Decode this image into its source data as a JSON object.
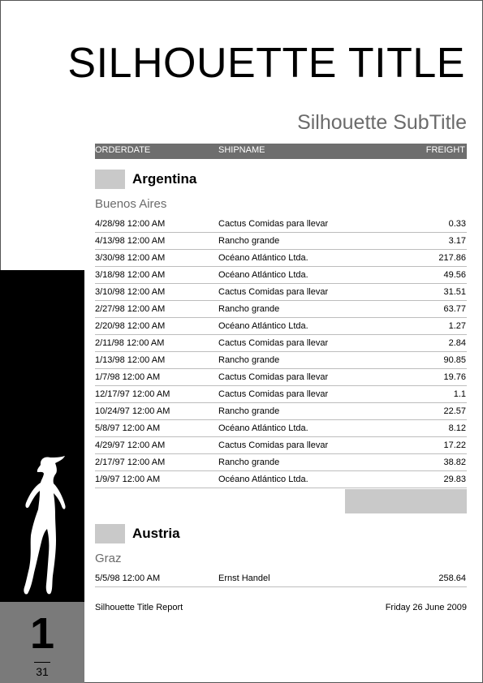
{
  "report": {
    "title": "SILHOUETTE TITLE",
    "subtitle": "Silhouette SubTitle"
  },
  "columns": {
    "orderdate": "ORDERDATE",
    "shipname": "SHIPNAME",
    "freight": "FREIGHT"
  },
  "groups": [
    {
      "country": "Argentina",
      "city": "Buenos Aires",
      "rows": [
        {
          "date": "4/28/98 12:00 AM",
          "ship": "Cactus Comidas para llevar",
          "freight": "0.33"
        },
        {
          "date": "4/13/98 12:00 AM",
          "ship": "Rancho grande",
          "freight": "3.17"
        },
        {
          "date": "3/30/98 12:00 AM",
          "ship": "Océano Atlántico Ltda.",
          "freight": "217.86"
        },
        {
          "date": "3/18/98 12:00 AM",
          "ship": "Océano Atlántico Ltda.",
          "freight": "49.56"
        },
        {
          "date": "3/10/98 12:00 AM",
          "ship": "Cactus Comidas para llevar",
          "freight": "31.51"
        },
        {
          "date": "2/27/98 12:00 AM",
          "ship": "Rancho grande",
          "freight": "63.77"
        },
        {
          "date": "2/20/98 12:00 AM",
          "ship": "Océano Atlántico Ltda.",
          "freight": "1.27"
        },
        {
          "date": "2/11/98 12:00 AM",
          "ship": "Cactus Comidas para llevar",
          "freight": "2.84"
        },
        {
          "date": "1/13/98 12:00 AM",
          "ship": "Rancho grande",
          "freight": "90.85"
        },
        {
          "date": "1/7/98 12:00 AM",
          "ship": "Cactus Comidas para llevar",
          "freight": "19.76"
        },
        {
          "date": "12/17/97 12:00 AM",
          "ship": "Cactus Comidas para llevar",
          "freight": "1.1"
        },
        {
          "date": "10/24/97 12:00 AM",
          "ship": "Rancho grande",
          "freight": "22.57"
        },
        {
          "date": "5/8/97 12:00 AM",
          "ship": "Océano Atlántico Ltda.",
          "freight": "8.12"
        },
        {
          "date": "4/29/97 12:00 AM",
          "ship": "Cactus Comidas para llevar",
          "freight": "17.22"
        },
        {
          "date": "2/17/97 12:00 AM",
          "ship": "Rancho grande",
          "freight": "38.82"
        },
        {
          "date": "1/9/97 12:00 AM",
          "ship": "Océano Atlántico Ltda.",
          "freight": "29.83"
        }
      ]
    },
    {
      "country": "Austria",
      "city": "Graz",
      "rows": [
        {
          "date": "5/5/98 12:00 AM",
          "ship": "Ernst Handel",
          "freight": "258.64"
        }
      ]
    }
  ],
  "footer": {
    "report_name": "Silhouette Title Report",
    "date": "Friday 26 June 2009"
  },
  "page": {
    "number": "1",
    "total": "31"
  },
  "colors": {
    "header_bg": "#6e6e6e",
    "group_box": "#c9c9c9",
    "city_text": "#6b6b6b",
    "side_black": "#000000",
    "side_gray": "#7a7a7a"
  }
}
